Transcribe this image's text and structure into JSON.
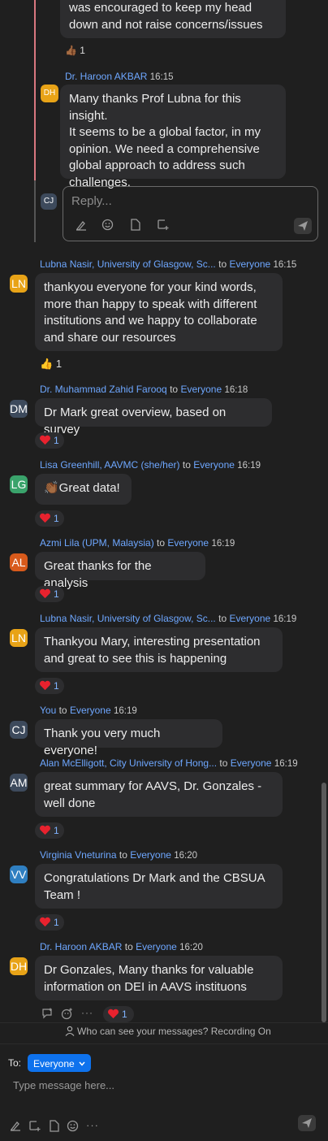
{
  "thread": {
    "prev_message_lines": [
      "was encouraged to keep my head",
      "down and not raise concerns/issues"
    ],
    "prev_reaction": {
      "emoji": "👍🏾",
      "count": "1"
    },
    "reply": {
      "avatar": "DH",
      "name": "Dr. Haroon AKBAR",
      "time": "16:15",
      "lines": [
        "Many thanks Prof Lubna for this insight.",
        "It seems to be a global factor, in my",
        "opinion. We need a comprehensive",
        "global approach to address such",
        "challenges."
      ]
    },
    "reply_box": {
      "avatar": "CJ",
      "placeholder": "Reply..."
    }
  },
  "messages": [
    {
      "avatar": "LN",
      "name": "Lubna Nasir, University of Glasgow, Sc...",
      "to": "to",
      "target": "Everyone",
      "time": "16:15",
      "lines": [
        "thankyou everyone for your kind words,",
        "more than happy to speak with different",
        "institutions and we happy to collaborate",
        "and share our resources"
      ],
      "reaction": {
        "emoji": "👍",
        "count": "1"
      }
    },
    {
      "avatar": "DM",
      "name": "Dr. Muhammad Zahid Farooq",
      "to": "to",
      "target": "Everyone",
      "time": "16:18",
      "lines": [
        "Dr Mark great overview, based on survey"
      ],
      "reaction": {
        "emoji": "❤️",
        "count": "1"
      }
    },
    {
      "avatar": "LG",
      "name": "Lisa Greenhill, AAVMC (she/her)",
      "to": "to",
      "target": "Everyone",
      "time": "16:19",
      "lines": [
        "👏🏾Great data!"
      ],
      "reaction": {
        "emoji": "❤️",
        "count": "1"
      }
    },
    {
      "avatar": "AL",
      "name": "Azmi Lila (UPM, Malaysia)",
      "to": "to",
      "target": "Everyone",
      "time": "16:19",
      "lines": [
        "Great thanks for the analysis"
      ],
      "reaction": {
        "emoji": "❤️",
        "count": "1"
      }
    },
    {
      "avatar": "LN",
      "name": "Lubna Nasir, University of Glasgow, Sc...",
      "to": "to",
      "target": "Everyone",
      "time": "16:19",
      "lines": [
        "Thankyou Mary, interesting presentation",
        "and great to see this is happening"
      ],
      "reaction": {
        "emoji": "❤️",
        "count": "1"
      }
    },
    {
      "avatar": "CJ",
      "name": "You",
      "to": "to",
      "target": "Everyone",
      "time": "16:19",
      "lines": [
        "Thank you very much everyone!"
      ]
    },
    {
      "avatar": "AM",
      "name": "Alan McElligott, City University of Hong...",
      "to": "to",
      "target": "Everyone",
      "time": "16:19",
      "lines": [
        "great summary for AAVS, Dr. Gonzales -",
        "well done"
      ],
      "reaction": {
        "emoji": "❤️",
        "count": "1"
      }
    },
    {
      "avatar": "VV",
      "name": "Virginia Vneturina",
      "to": "to",
      "target": "Everyone",
      "time": "16:20",
      "lines": [
        "Congratulations Dr Mark and the CBSUA",
        "Team !"
      ],
      "reaction": {
        "emoji": "❤️",
        "count": "1"
      }
    },
    {
      "avatar": "DH",
      "name": "Dr. Haroon AKBAR",
      "to": "to",
      "target": "Everyone",
      "time": "16:20",
      "lines": [
        "Dr Gonzales, Many thanks for valuable",
        "information on DEI in AAVS instituons"
      ],
      "reaction": {
        "emoji": "❤️",
        "count": "1"
      }
    }
  ],
  "privacy_notice": "Who can see your messages? Recording On",
  "composer": {
    "to_label": "To:",
    "recipient": "Everyone",
    "placeholder": "Type message here..."
  },
  "colors": {
    "background": "#1f1f1f",
    "bubble": "#2d2d2f",
    "accent": "#0e72ed",
    "link": "#6ea7ff",
    "avatar_ln": "#e8a317",
    "avatar_dm": "#3d4a5c",
    "avatar_lg": "#3aa36b",
    "avatar_al": "#d85a1b",
    "avatar_cj": "#3d4a5c",
    "avatar_am": "#3d4a5c",
    "avatar_vv": "#2f7fc1",
    "avatar_dh": "#e8a317"
  }
}
